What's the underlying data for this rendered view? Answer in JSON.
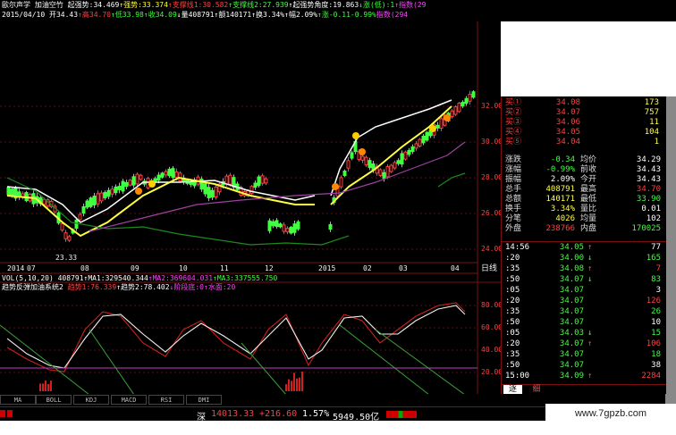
{
  "header": {
    "line1": [
      {
        "text": "歐尔声学 加油空竹",
        "color": "#ffffff"
      },
      {
        "text": " 起强势:34.469",
        "color": "#ffffff"
      },
      {
        "text": "↑强势:33.374",
        "color": "#ffff40"
      },
      {
        "text": "↑支撑线1:30.582",
        "color": "#ff4040"
      },
      {
        "text": "↑支撑线2:27.939",
        "color": "#40ff40"
      },
      {
        "text": "↑起强势角度:19.863",
        "color": "#ffffff"
      },
      {
        "text": "↓涨(低):1",
        "color": "#40ff40"
      },
      {
        "text": "↑指数(29",
        "color": "#ff40ff"
      }
    ],
    "line2": [
      {
        "text": "2015/04/10 开34.43",
        "color": "#ffffff"
      },
      {
        "text": "↑高34.70",
        "color": "#ff4040"
      },
      {
        "text": "↑低33.98",
        "color": "#40ff40"
      },
      {
        "text": "↑收34.09",
        "color": "#40ff40"
      },
      {
        "text": "↓量408791",
        "color": "#ffffff"
      },
      {
        "text": "↑额140171",
        "color": "#ffffff"
      },
      {
        "text": "↑换3.34%",
        "color": "#ffffff"
      },
      {
        "text": "↑幅2.09%",
        "color": "#ffffff"
      },
      {
        "text": "↑涨-0.11-0.99%",
        "color": "#40ff40"
      },
      {
        "text": "指数(294",
        "color": "#ff40ff"
      }
    ]
  },
  "price_axis": [
    "32.00",
    "30.00",
    "28.00",
    "26.00",
    "24.00"
  ],
  "low_marker": "23.33",
  "dates": [
    "2014",
    "07",
    "08",
    "09",
    "10",
    "11",
    "12",
    "2015",
    "02",
    "03",
    "04"
  ],
  "period_label": "日线",
  "vol_line": [
    {
      "text": "VOL(5,10,20) 408791",
      "color": "#ffffff"
    },
    {
      "text": "↑MA1:329540.344",
      "color": "#ffffff"
    },
    {
      "text": "↑MA2:369604.031",
      "color": "#ff40ff"
    },
    {
      "text": "↑MA3:337555.750",
      "color": "#40ff40"
    }
  ],
  "ind_line": [
    {
      "text": "趋势反弹加油系统2",
      "color": "#ffffff"
    },
    {
      "text": " 趋势1:76.339",
      "color": "#ff4040"
    },
    {
      "text": "↑趋势2:78.402",
      "color": "#ffffff"
    },
    {
      "text": "↓阶段底:0",
      "color": "#ff40ff"
    },
    {
      "text": "↑水面:20",
      "color": "#ff40ff"
    }
  ],
  "ind_axis": [
    "80.00",
    "60.00",
    "40.00",
    "20.00"
  ],
  "tabs": [
    "MA",
    "BOLL",
    "KDJ",
    "MACD",
    "RSI",
    "DMI"
  ],
  "buy_levels": [
    {
      "label": "买①",
      "price": "34.08",
      "vol": "173"
    },
    {
      "label": "买②",
      "price": "34.07",
      "vol": "757"
    },
    {
      "label": "买③",
      "price": "34.06",
      "vol": "11"
    },
    {
      "label": "买④",
      "price": "34.05",
      "vol": "104"
    },
    {
      "label": "买⑤",
      "price": "34.04",
      "vol": "1"
    }
  ],
  "stats": [
    {
      "l1": "涨跌",
      "v1": "-0.34",
      "c1": "#40ff40",
      "l2": "均价",
      "v2": "34.29",
      "c2": "#ffffff"
    },
    {
      "l1": "涨幅",
      "v1": "-0.99%",
      "c1": "#40ff40",
      "l2": "前收",
      "v2": "34.43",
      "c2": "#ffffff"
    },
    {
      "l1": "振幅",
      "v1": "2.09%",
      "c1": "#ffffff",
      "l2": "今开",
      "v2": "34.43",
      "c2": "#ffffff"
    },
    {
      "l1": "总手",
      "v1": "408791",
      "c1": "#ffff40",
      "l2": "最高",
      "v2": "34.70",
      "c2": "#ff4040"
    },
    {
      "l1": "总额",
      "v1": "140171",
      "c1": "#ffff40",
      "l2": "最低",
      "v2": "33.90",
      "c2": "#40ff40"
    },
    {
      "l1": "换手",
      "v1": "3.34%",
      "c1": "#ffff40",
      "l2": "量比",
      "v2": "0.01",
      "c2": "#ffffff"
    },
    {
      "l1": "分笔",
      "v1": "4026",
      "c1": "#ffff40",
      "l2": "均量",
      "v2": "102",
      "c2": "#ffffff"
    },
    {
      "l1": "外盘",
      "v1": "238766",
      "c1": "#ff4040",
      "l2": "内盘",
      "v2": "170025",
      "c2": "#40ff40"
    }
  ],
  "trades": [
    {
      "time": "14:56",
      "price": "34.05",
      "arrow": "↑",
      "ac": "#ff4040",
      "vol": "77",
      "vc": "#ffffff"
    },
    {
      "time": ":20",
      "price": "34.00",
      "arrow": "↓",
      "ac": "#40ff40",
      "vol": "165",
      "vc": "#40ff40"
    },
    {
      "time": ":35",
      "price": "34.08",
      "arrow": "↑",
      "ac": "#ff4040",
      "vol": "7",
      "vc": "#ff4040"
    },
    {
      "time": ":50",
      "price": "34.07",
      "arrow": "↓",
      "ac": "#40ff40",
      "vol": "83",
      "vc": "#40ff40"
    },
    {
      "time": ":05",
      "price": "34.07",
      "arrow": "",
      "ac": "#ffffff",
      "vol": "3",
      "vc": "#ffffff"
    },
    {
      "time": ":20",
      "price": "34.07",
      "arrow": "",
      "ac": "#ffffff",
      "vol": "126",
      "vc": "#ff4040"
    },
    {
      "time": ":35",
      "price": "34.07",
      "arrow": "",
      "ac": "#ffffff",
      "vol": "26",
      "vc": "#40ff40"
    },
    {
      "time": ":50",
      "price": "34.07",
      "arrow": "",
      "ac": "#ffffff",
      "vol": "10",
      "vc": "#ffffff"
    },
    {
      "time": ":05",
      "price": "34.03",
      "arrow": "↓",
      "ac": "#40ff40",
      "vol": "15",
      "vc": "#40ff40"
    },
    {
      "time": ":20",
      "price": "34.07",
      "arrow": "↑",
      "ac": "#ff4040",
      "vol": "106",
      "vc": "#ff4040"
    },
    {
      "time": ":35",
      "price": "34.07",
      "arrow": "",
      "ac": "#ffffff",
      "vol": "18",
      "vc": "#40ff40"
    },
    {
      "time": ":50",
      "price": "34.07",
      "arrow": "",
      "ac": "#ffffff",
      "vol": "38",
      "vc": "#ffffff"
    },
    {
      "time": "15:00",
      "price": "34.09",
      "arrow": "↑",
      "ac": "#ff4040",
      "vol": "2284",
      "vc": "#ff4040"
    }
  ],
  "bottom_tabs": [
    "逐",
    "细"
  ],
  "status": {
    "market": "深",
    "index": "14013.33",
    "change": "+216.60",
    "pct": "1.57%",
    "amount": "5949.50亿"
  },
  "watermark": "www.7gpzb.com"
}
